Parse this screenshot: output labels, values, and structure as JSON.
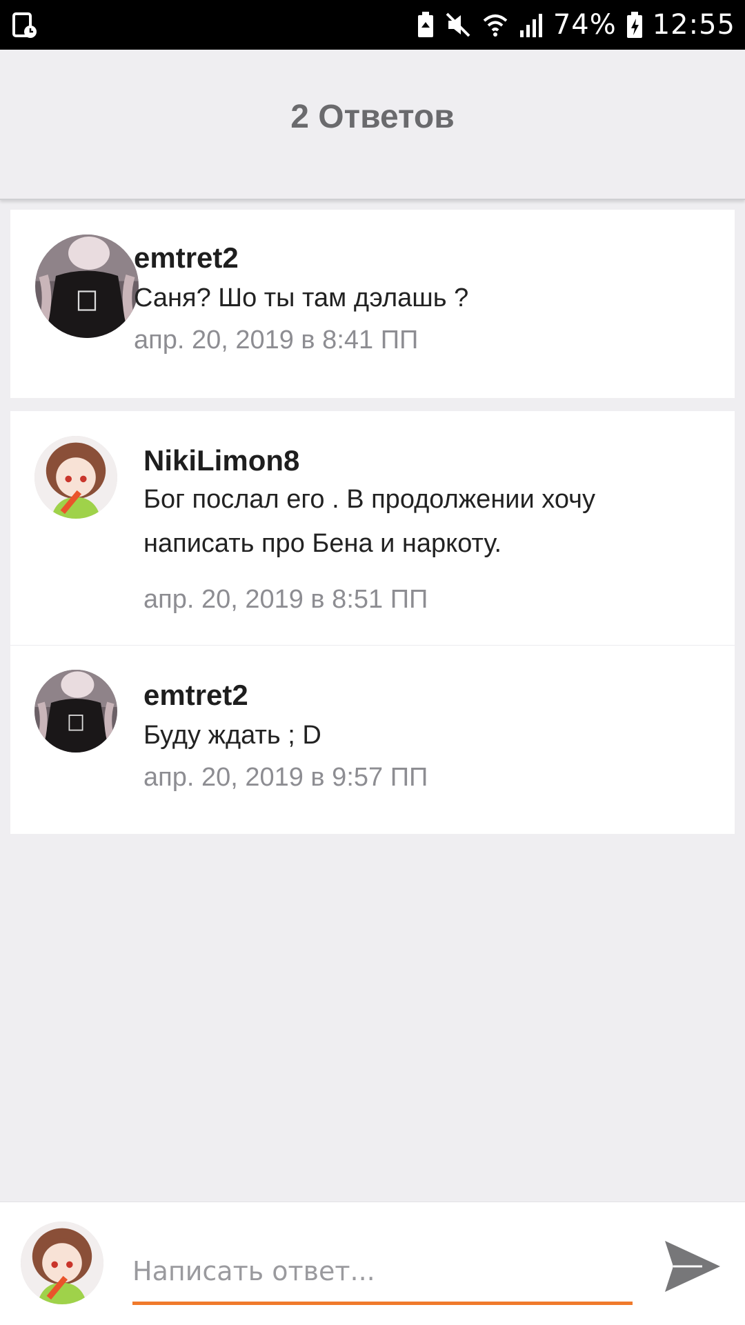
{
  "status_bar": {
    "battery": "74%",
    "time": "12:55",
    "icons": [
      "screen-record-icon",
      "battery-saver-icon",
      "mute-icon",
      "wifi-icon",
      "signal-icon",
      "battery-charging-icon"
    ]
  },
  "header": {
    "title": "2 Ответов"
  },
  "thread": {
    "original": {
      "username": "emtret2",
      "message": "Саня? Шо ты там дэлашь ?",
      "timestamp": "апр. 20, 2019 в 8:41 ПП"
    },
    "replies": [
      {
        "username": "NikiLimon8",
        "message": "Бог послал его . В продолжении хочу написать про Бена и наркоту.",
        "timestamp": "апр. 20, 2019 в 8:51 ПП"
      },
      {
        "username": "emtret2",
        "message": "Буду ждать ; D",
        "timestamp": "апр. 20, 2019 в 9:57 ПП"
      }
    ]
  },
  "reply_box": {
    "placeholder": "Написать ответ...",
    "accent_color": "#f07a2c"
  }
}
